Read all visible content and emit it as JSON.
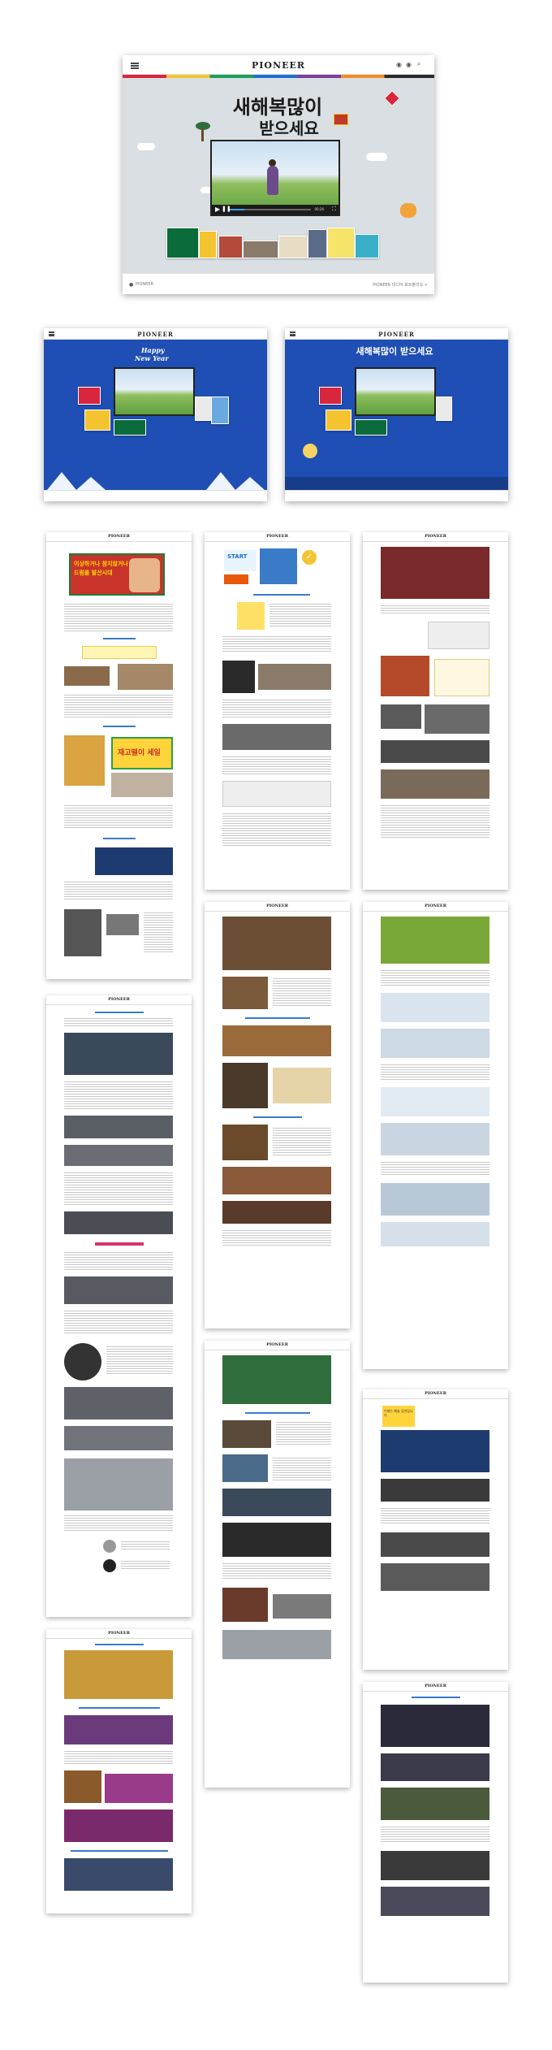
{
  "hero": {
    "logo": "PIONEER",
    "title_line1": "새해복많이",
    "title_line2": "받으세요",
    "footer_left": "PIONEER",
    "footer_right": "PIONEER 미디어 포트폴리오 >",
    "video": {
      "time_elapsed": "00:26",
      "time_total": "02:45",
      "progress": 0.18
    }
  },
  "blue_left": {
    "logo": "PIONEER",
    "badge_line1": "Happy",
    "badge_line2": "New Year"
  },
  "blue_right": {
    "logo": "PIONEER",
    "title": "새해복많이 받으세요"
  },
  "pages": {
    "logo": "PIONEER",
    "headline_sign": "이상하거나 참지않거나 드럼을 발산시대",
    "tag_start": "START",
    "sale_sign": "재고떨이 세일",
    "teaser_sign": "이제는 예술 공연입니다"
  },
  "colors": {
    "hero_bg": "#d9dfe2",
    "blue_bg": "#1f4fb4",
    "accent": "#3a7bc8",
    "logo": "#222222"
  }
}
